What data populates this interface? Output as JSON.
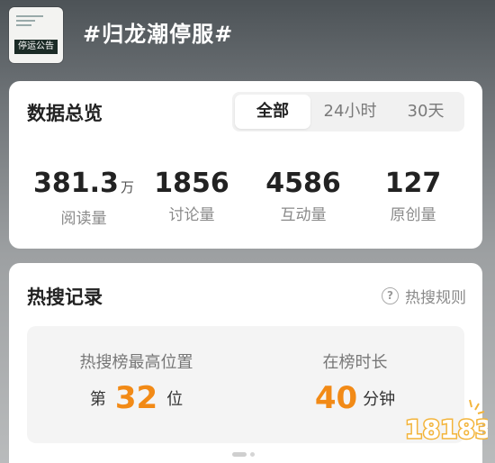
{
  "header": {
    "topic_title": "#归龙潮停服#",
    "thumbnail_banner": "停运公告"
  },
  "overview": {
    "title": "数据总览",
    "tabs": [
      {
        "label": "全部",
        "active": true
      },
      {
        "label": "24小时",
        "active": false
      },
      {
        "label": "30天",
        "active": false
      }
    ],
    "stats": [
      {
        "value": "381.3",
        "unit": "万",
        "label": "阅读量"
      },
      {
        "value": "1856",
        "unit": "",
        "label": "讨论量"
      },
      {
        "value": "4586",
        "unit": "",
        "label": "互动量"
      },
      {
        "value": "127",
        "unit": "",
        "label": "原创量"
      }
    ]
  },
  "hot_search": {
    "title": "热搜记录",
    "rules_label": "热搜规则",
    "highest": {
      "label": "热搜榜最高位置",
      "prefix": "第",
      "value": "32",
      "suffix": "位"
    },
    "duration": {
      "label": "在榜时长",
      "value": "40",
      "suffix": "分钟"
    }
  },
  "watermark": {
    "text": "18183"
  },
  "colors": {
    "accent": "#f28a16",
    "watermark": "#f3b43a"
  }
}
